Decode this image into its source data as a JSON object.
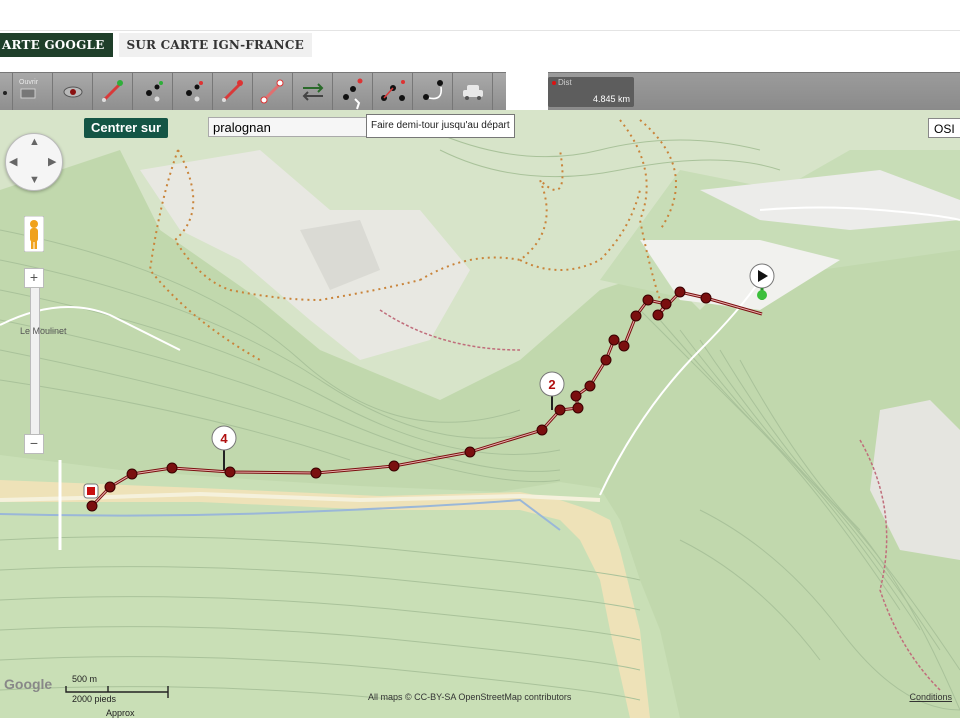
{
  "tabs": [
    {
      "label": "ARTE GOOGLE",
      "active": true
    },
    {
      "label": "SUR CARTE IGN-FRANCE",
      "active": false
    }
  ],
  "toolbar": {
    "buttons": [
      {
        "name": "nav-back",
        "icon": "small-marker-icon"
      },
      {
        "name": "open-button",
        "icon": "open-icon",
        "label": "Ouvrir"
      },
      {
        "name": "view-button",
        "icon": "eye-icon"
      },
      {
        "name": "line-start-button",
        "icon": "segment-green-icon"
      },
      {
        "name": "add-point-button",
        "icon": "point-add-icon"
      },
      {
        "name": "insert-point-button",
        "icon": "point-insert-icon"
      },
      {
        "name": "segment-red-button",
        "icon": "segment-red-icon"
      },
      {
        "name": "delete-segment-button",
        "icon": "segment-delete-icon"
      },
      {
        "name": "reverse-button",
        "icon": "reverse-arrows-icon"
      },
      {
        "name": "return-start-button",
        "icon": "return-start-icon"
      },
      {
        "name": "waypoints-button",
        "icon": "waypoints-icon"
      },
      {
        "name": "loop-button",
        "icon": "loop-icon"
      },
      {
        "name": "car-button",
        "icon": "car-icon"
      }
    ]
  },
  "distance": {
    "label": "Dist",
    "value": "4.845 km"
  },
  "map": {
    "centrer_label": "Centrer sur",
    "search_value": "pralognan",
    "tooltip": "Faire demi-tour jusqu'au départ",
    "osm_label": "OSI",
    "place_label": "Le Moulinet",
    "markers": [
      {
        "label": "2"
      },
      {
        "label": "4"
      }
    ],
    "scale_metric": "500 m",
    "scale_imperial": "2000 pieds",
    "approx_label": "Approx",
    "attribution": "All maps © CC-BY-SA OpenStreetMap contributors",
    "conditions": "Conditions",
    "route_color": "#7a0f0f",
    "trail_color": "#c9843a"
  }
}
